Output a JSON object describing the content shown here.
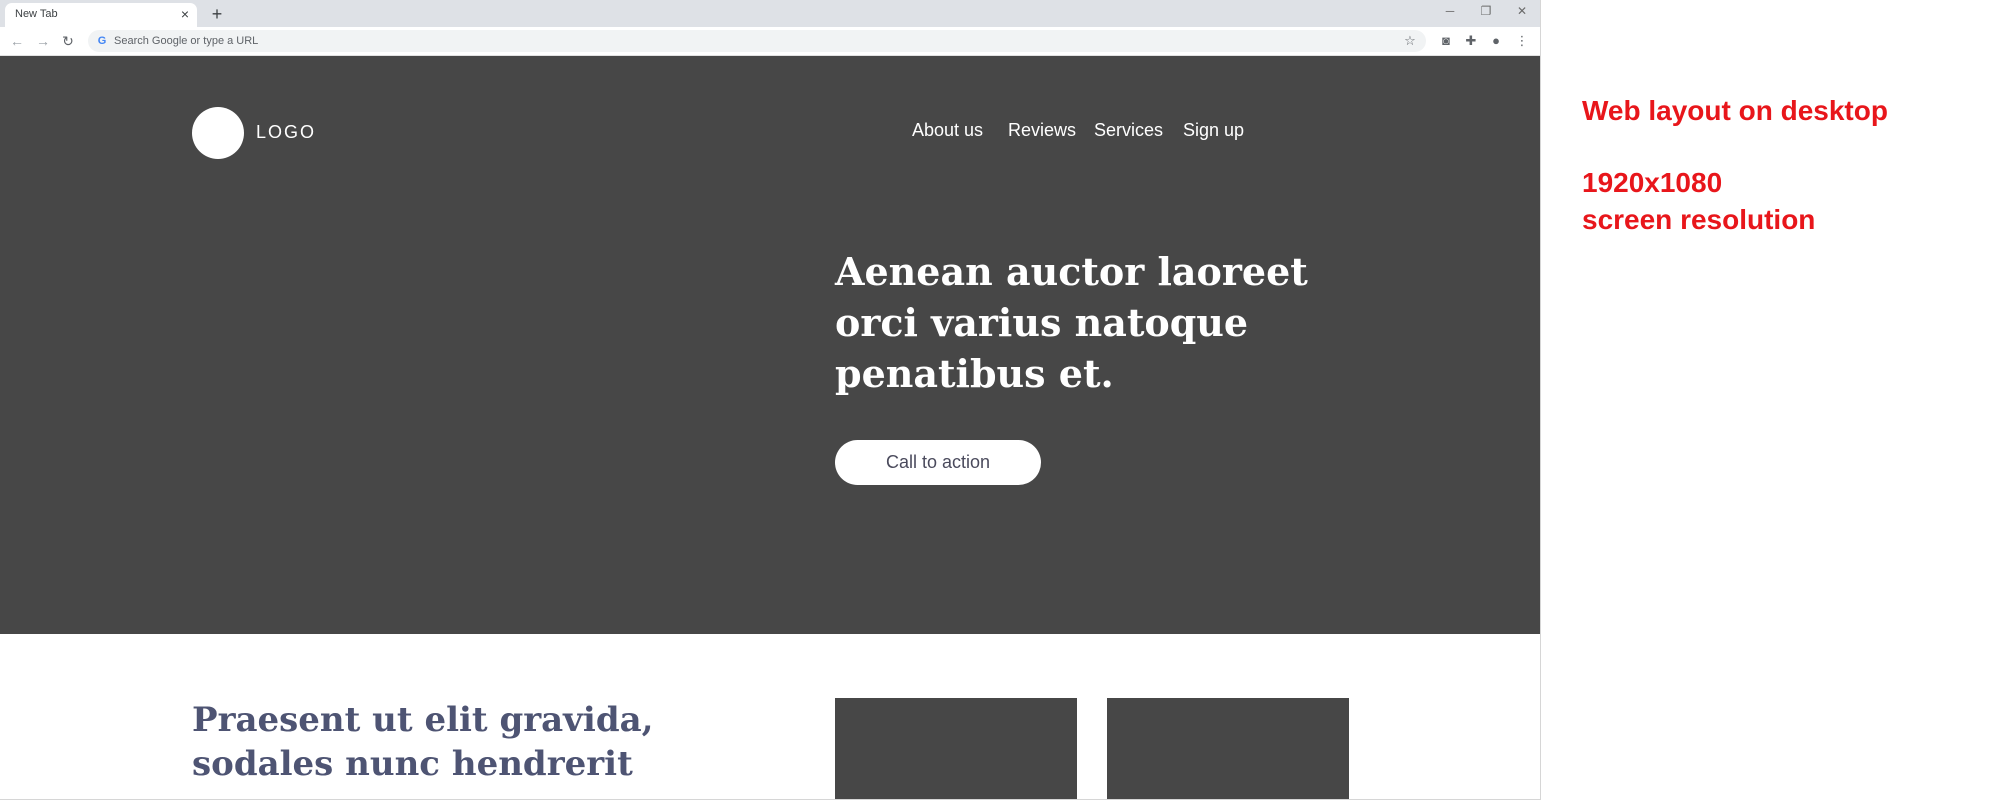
{
  "browser": {
    "tab_title": "New Tab",
    "tab_close_icon": "close-icon",
    "new_tab_icon": "plus-icon",
    "omnibox_placeholder": "Search Google or type a URL",
    "window_controls": [
      "minimize-icon",
      "restore-icon",
      "close-icon"
    ],
    "toolbar_icons": [
      "back-icon",
      "forward-icon",
      "reload-icon",
      "bookmark-star-icon",
      "camera-icon",
      "extensions-icon",
      "profile-icon",
      "menu-icon"
    ]
  },
  "site": {
    "logo_text": "LOGO",
    "nav": [
      "About us",
      "Reviews",
      "Services",
      "Sign up"
    ],
    "hero": {
      "title_lines": [
        "Aenean auctor laoreet",
        "orci varius natoque",
        "penatibus et."
      ],
      "cta_label": "Call to action"
    },
    "section": {
      "title_lines": [
        "Praesent ut elit gravida,",
        "sodales nunc hendrerit"
      ]
    },
    "colors": {
      "hero_bg": "#474747",
      "section_title": "#4e5473",
      "annotation": "#e8161b"
    }
  },
  "annotation": {
    "line1": "Web layout on desktop",
    "line2": "1920x1080",
    "line3": "screen resolution"
  }
}
